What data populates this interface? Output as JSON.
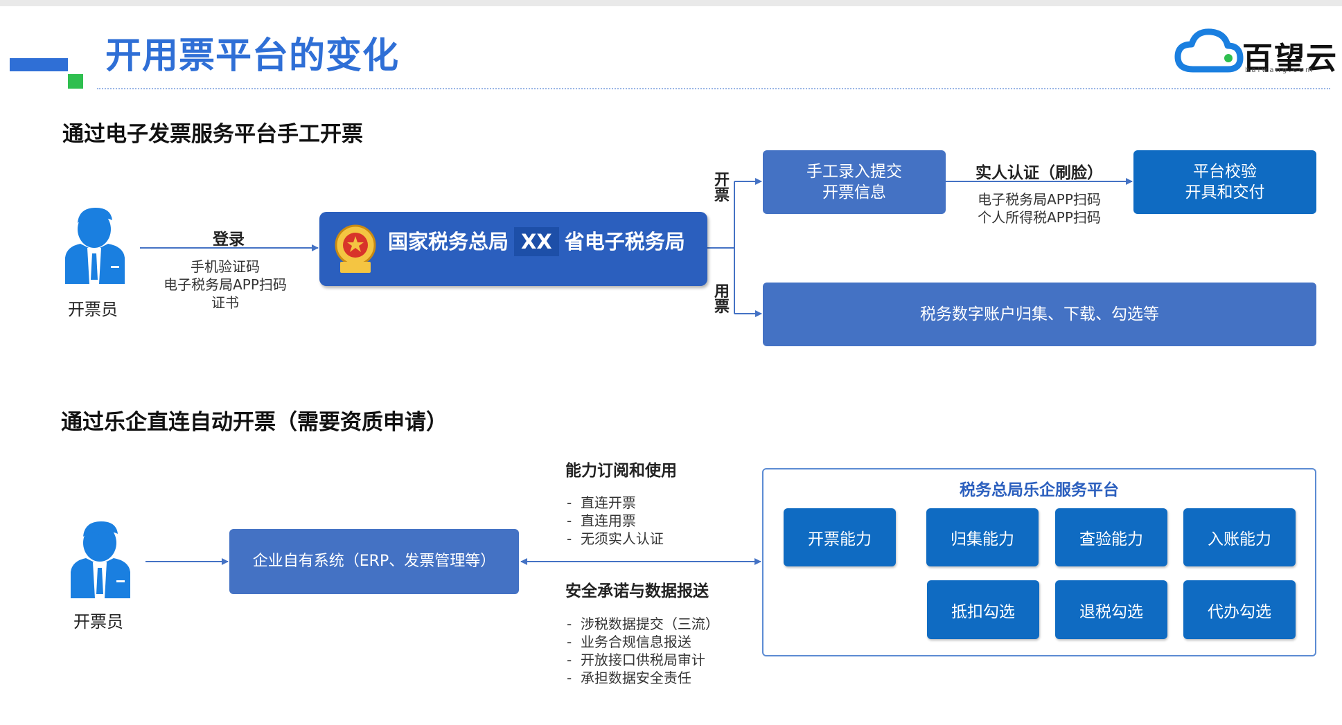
{
  "header": {
    "title": "开用票平台的变化",
    "brand_name": "百望云",
    "brand_domain": "baiwang.com",
    "colors": {
      "title": "#2f6fd6",
      "accent_green": "#2fbf4f",
      "box_blue": "#4472c4",
      "box_dark": "#0f6bc2"
    }
  },
  "section1": {
    "title": "通过电子发票服务平台手工开票",
    "actor": {
      "icon": "person-icon",
      "label": "开票员"
    },
    "login": {
      "label": "登录",
      "methods": [
        "手机验证码",
        "电子税务局APP扫码",
        "证书"
      ]
    },
    "tax_platform": {
      "logo": "tax-emblem-icon",
      "name_left": "国家税务总局",
      "name_xx": "XX",
      "name_right": "省电子税务局"
    },
    "issue_branch": {
      "label": [
        "开",
        "票"
      ],
      "box1": [
        "手工录入提交",
        "开票信息"
      ],
      "auth_label": "实人认证（刷脸）",
      "auth_methods": [
        "电子税务局APP扫码",
        "个人所得税APP扫码"
      ],
      "box2": [
        "平台校验",
        "开具和交付"
      ]
    },
    "use_branch": {
      "label": [
        "用",
        "票"
      ],
      "box": "税务数字账户归集、下载、勾选等"
    }
  },
  "section2": {
    "title": "通过乐企直连自动开票（需要资质申请）",
    "actor": {
      "icon": "person-icon",
      "label": "开票员"
    },
    "erp_box": "企业自有系统（ERP、发票管理等）",
    "subscribe": {
      "title": "能力订阅和使用",
      "items": [
        "直连开票",
        "直连用票",
        "无须实人认证"
      ]
    },
    "security": {
      "title": "安全承诺与数据报送",
      "items": [
        "涉税数据提交（三流）",
        "业务合规信息报送",
        "开放接口供税局审计",
        "承担数据安全责任"
      ]
    },
    "platform": {
      "title": "税务总局乐企服务平台",
      "row1": [
        "开票能力",
        "归集能力",
        "查验能力",
        "入账能力"
      ],
      "row2": [
        "抵扣勾选",
        "退税勾选",
        "代办勾选"
      ]
    }
  }
}
